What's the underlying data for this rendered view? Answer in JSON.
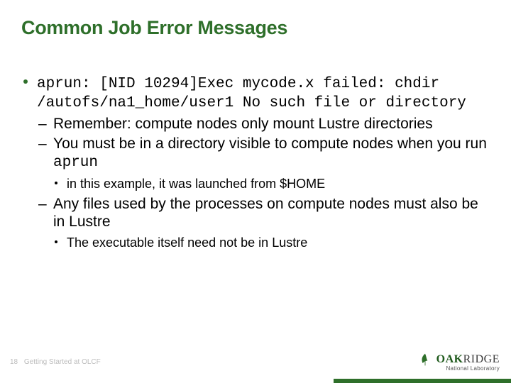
{
  "title": "Common Job Error Messages",
  "error_line": "aprun: [NID 10294]Exec mycode.x failed: chdir /autofs/na1_home/user1 No such file or directory",
  "sub1": "Remember: compute nodes only mount Lustre directories",
  "sub2_a": "You must be in a directory visible to compute nodes when you run ",
  "sub2_b": "aprun",
  "sub2_note": "in this example, it was launched from $HOME",
  "sub3": "Any files used by the processes on compute nodes must also be in Lustre",
  "sub3_note": "The executable itself need not be in Lustre",
  "footer": {
    "page": "18",
    "text": "Getting Started at OLCF"
  },
  "logo": {
    "line1a": "OAK",
    "line1b": "RIDGE",
    "line2": "National Laboratory"
  }
}
